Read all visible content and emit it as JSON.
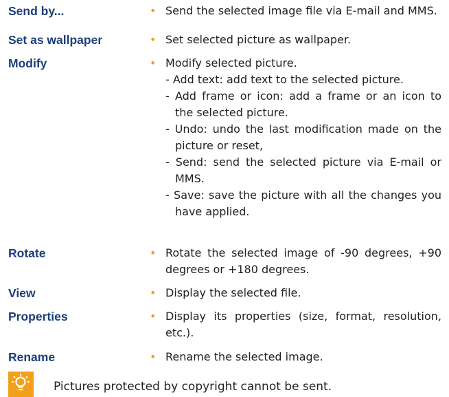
{
  "entries": [
    {
      "term": "Send by...",
      "lines": [
        "Send the selected image file via E-mail and MMS."
      ]
    },
    {
      "term": "Set as wallpaper",
      "lines": [
        "Set selected picture as wallpaper."
      ]
    },
    {
      "term": "Modify",
      "lines": [
        "Modify selected picture.",
        "- Add text: add text to the selected picture.",
        "- Add frame or icon: add a frame or an icon to",
        "the selected picture.",
        "- Undo: undo the last modification made on the",
        "picture or reset,",
        "- Send: send the selected picture via E-mail or",
        "MMS.",
        "- Save: save the picture with all the changes you",
        "have applied."
      ]
    },
    {
      "term": "Rotate",
      "lines": [
        "Rotate the selected image of -90 degrees, +90",
        "degrees or +180 degrees."
      ]
    },
    {
      "term": "View",
      "lines": [
        "Display the selected file."
      ]
    },
    {
      "term": "Properties",
      "lines": [
        "Display its properties (size, format, resolution,",
        "etc.)."
      ]
    },
    {
      "term": "Rename",
      "lines": [
        "Rename the selected image."
      ]
    }
  ],
  "note": {
    "icon": "tip-icon",
    "text": "Pictures protected by copyright cannot be sent."
  },
  "colors": {
    "term": "#1c3f7a",
    "bullet": "#f0a01c",
    "icon_bg": "#f0a01c"
  }
}
